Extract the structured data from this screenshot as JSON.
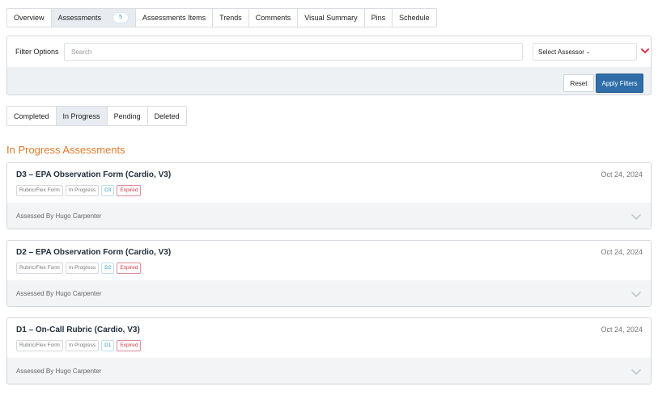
{
  "top_tabs": [
    {
      "label": "Overview"
    },
    {
      "label": "Assessments",
      "badge": "5"
    },
    {
      "label": "Assessments Items"
    },
    {
      "label": "Trends"
    },
    {
      "label": "Comments"
    },
    {
      "label": "Visual Summary"
    },
    {
      "label": "Pins"
    },
    {
      "label": "Schedule"
    }
  ],
  "filter": {
    "label": "Filter Options",
    "search_placeholder": "Search",
    "search_value": "",
    "assessor_select": "Select Assessor",
    "assessor_caret": "⌄",
    "reset_label": "Reset",
    "apply_label": "Apply Filters",
    "collapse_icon_color": "#d9374b",
    "apply_color": "#2f6ea8"
  },
  "status_tabs": [
    {
      "label": "Completed"
    },
    {
      "label": "In Progress"
    },
    {
      "label": "Pending"
    },
    {
      "label": "Deleted"
    }
  ],
  "section_title": "In Progress Assessments",
  "accent_color": "#e07b2b",
  "assessments": [
    {
      "title": "D3 – EPA Observation Form (Cardio, V3)",
      "date": "Oct 24, 2024",
      "tags": {
        "type": "Rubric/Flex Form",
        "status": "In Progress",
        "code": "D3",
        "expired": "Expired"
      },
      "assessed_by": "Assessed By Hugo Carpenter"
    },
    {
      "title": "D2 – EPA Observation Form (Cardio, V3)",
      "date": "Oct 24, 2024",
      "tags": {
        "type": "Rubric/Flex Form",
        "status": "In Progress",
        "code": "D2",
        "expired": "Expired"
      },
      "assessed_by": "Assessed By Hugo Carpenter"
    },
    {
      "title": "D1 – On-Call Rubric (Cardio, V3)",
      "date": "Oct 24, 2024",
      "tags": {
        "type": "Rubric/Flex Form",
        "status": "In Progress",
        "code": "D1",
        "expired": "Expired"
      },
      "assessed_by": "Assessed By Hugo Carpenter"
    }
  ]
}
